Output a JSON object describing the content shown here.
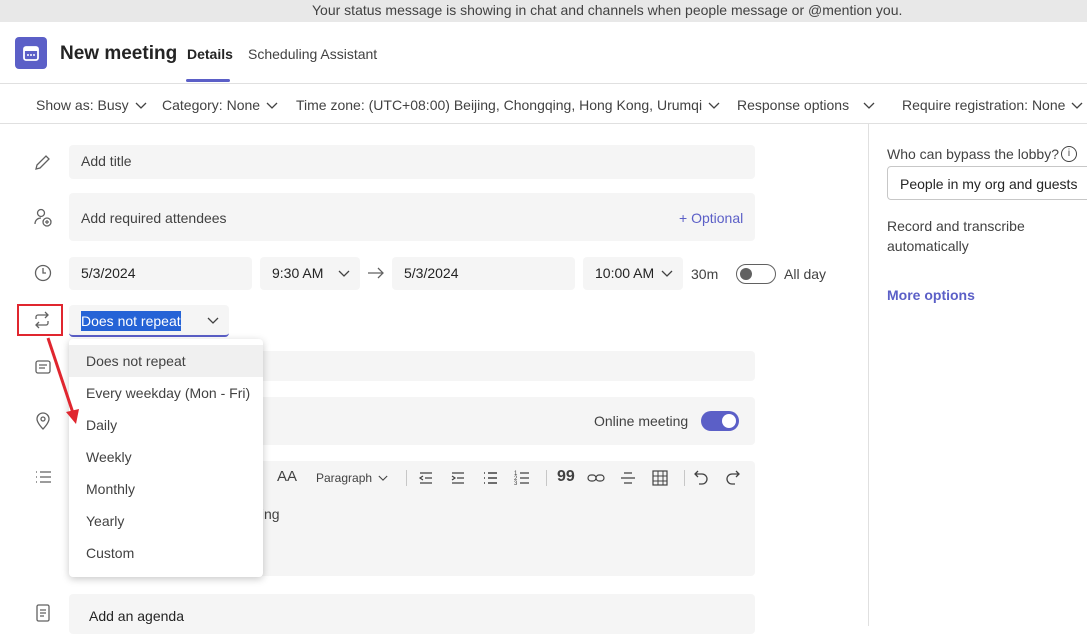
{
  "banner": {
    "text": "Your status message is showing in chat and channels when people message or @mention you."
  },
  "header": {
    "title": "New meeting",
    "tabs": [
      {
        "label": "Details"
      },
      {
        "label": "Scheduling Assistant"
      }
    ]
  },
  "options_bar": {
    "show_as": "Show as: Busy",
    "category": "Category: None",
    "time_zone": "Time zone: (UTC+08:00) Beijing, Chongqing, Hong Kong, Urumqi",
    "response_options": "Response options",
    "require_registration": "Require registration: None"
  },
  "form": {
    "title_placeholder": "Add title",
    "attendees_placeholder": "Add required attendees",
    "optional_link": "+ Optional",
    "start_date": "5/3/2024",
    "start_time": "9:30 AM",
    "end_date": "5/3/2024",
    "end_time": "10:00 AM",
    "duration": "30m",
    "all_day_label": "All day",
    "all_day_on": false,
    "repeat_value": "Does not repeat",
    "online_meeting_label": "Online meeting",
    "online_meeting_on": true,
    "editor_partial_text": "ting",
    "agenda_placeholder": "Add an agenda"
  },
  "repeat_dropdown": {
    "options": [
      "Does not repeat",
      "Every weekday (Mon - Fri)",
      "Daily",
      "Weekly",
      "Monthly",
      "Yearly",
      "Custom"
    ],
    "selected": "Does not repeat"
  },
  "editor_toolbar": {
    "paragraph_label": "Paragraph"
  },
  "right_panel": {
    "lobby_label": "Who can bypass the lobby?",
    "lobby_value": "People in my org and guests",
    "record_label": "Record and transcribe automatically",
    "more_options": "More options"
  },
  "colors": {
    "accent": "#5b5fc7",
    "annotation_red": "#e0262f",
    "selection_blue": "#2563d6"
  }
}
